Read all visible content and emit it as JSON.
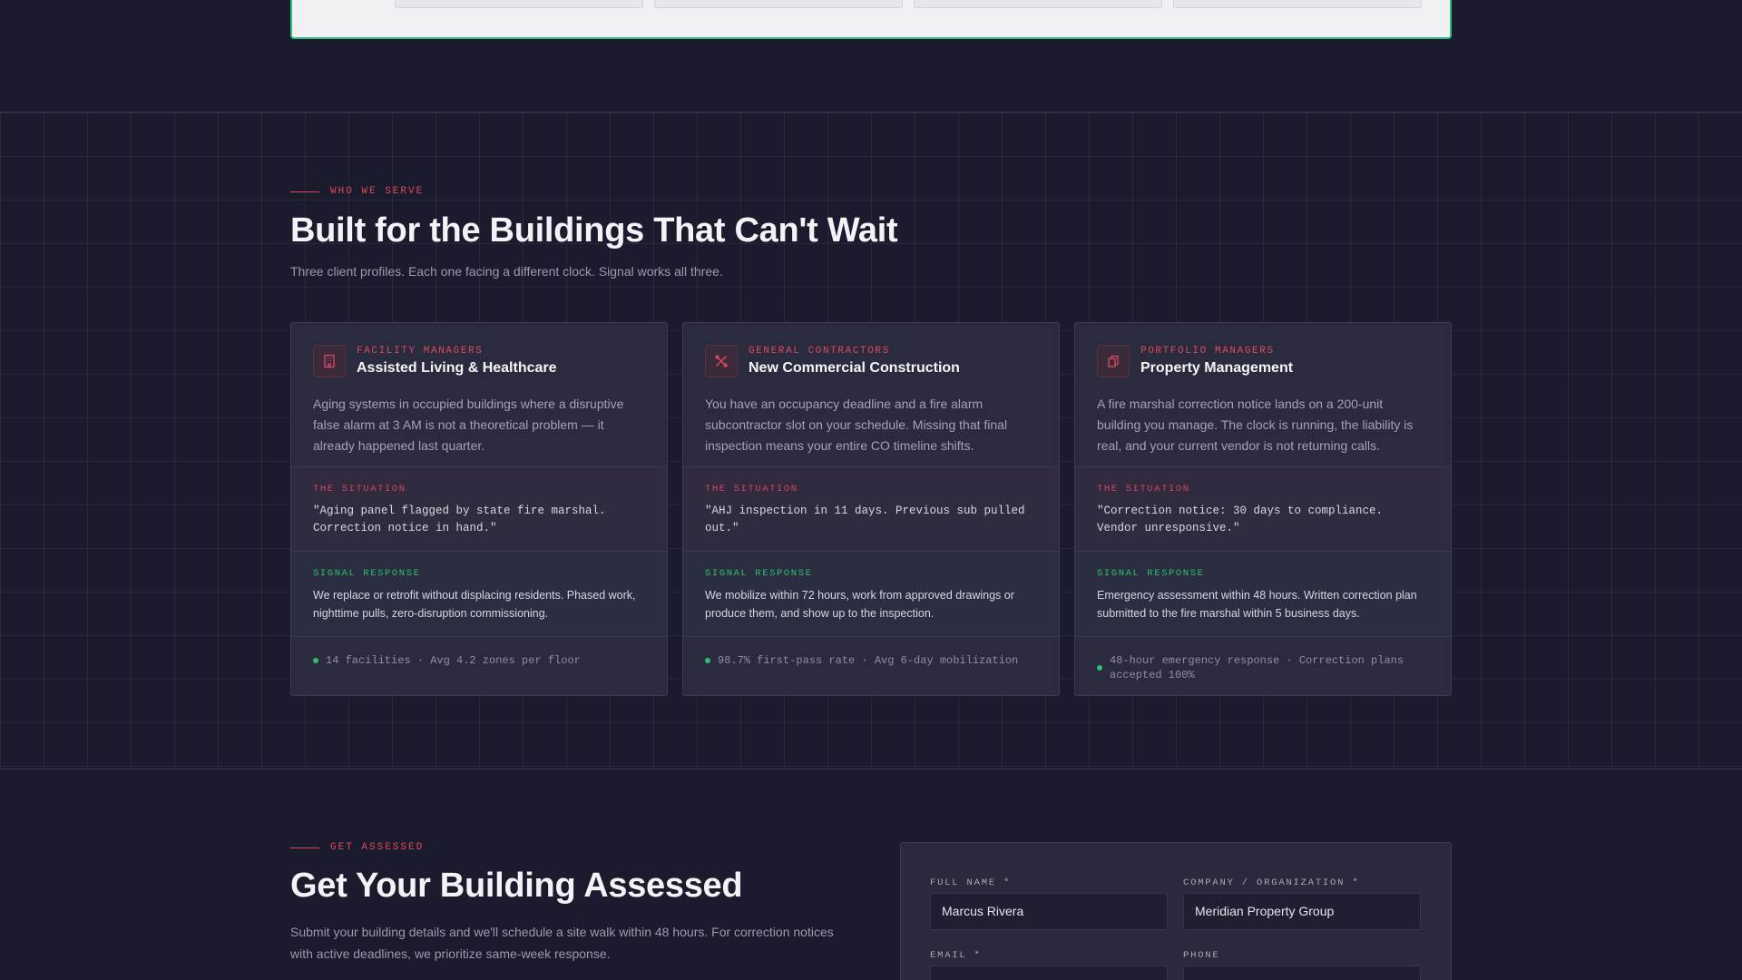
{
  "colors": {
    "background": "#1b1b2e",
    "accent": "#e0485c",
    "success": "#2fbf6e",
    "card": "#2a2b3e"
  },
  "who_we_serve": {
    "eyebrow": "WHO WE SERVE",
    "heading": "Built for the Buildings That Can't Wait",
    "subheading": "Three client profiles. Each one facing a different clock. Signal works all three.",
    "situation_label": "THE SITUATION",
    "response_label": "SIGNAL RESPONSE",
    "cards": [
      {
        "icon": "building-icon",
        "category": "FACILITY MANAGERS",
        "title": "Assisted Living & Healthcare",
        "description": "Aging systems in occupied buildings where a disruptive false alarm at 3 AM is not a theoretical problem — it already happened last quarter.",
        "situation": "\"Aging panel flagged by state fire marshal. Correction notice in hand.\"",
        "response": "We replace or retrofit without displacing residents. Phased work, nighttime pulls, zero-disruption commissioning.",
        "stat": "14 facilities · Avg 4.2 zones per floor"
      },
      {
        "icon": "tools-icon",
        "category": "GENERAL CONTRACTORS",
        "title": "New Commercial Construction",
        "description": "You have an occupancy deadline and a fire alarm subcontractor slot on your schedule. Missing that final inspection means your entire CO timeline shifts.",
        "situation": "\"AHJ inspection in 11 days. Previous sub pulled out.\"",
        "response": "We mobilize within 72 hours, work from approved drawings or produce them, and show up to the inspection.",
        "stat": "98.7% first-pass rate · Avg 6-day mobilization"
      },
      {
        "icon": "documents-icon",
        "category": "PORTFOLIO MANAGERS",
        "title": "Property Management",
        "description": "A fire marshal correction notice lands on a 200-unit building you manage. The clock is running, the liability is real, and your current vendor is not returning calls.",
        "situation": "\"Correction notice: 30 days to compliance. Vendor unresponsive.\"",
        "response": "Emergency assessment within 48 hours. Written correction plan submitted to the fire marshal within 5 business days.",
        "stat": "48-hour emergency response · Correction plans accepted 100%"
      }
    ]
  },
  "get_assessed": {
    "eyebrow": "GET ASSESSED",
    "heading": "Get Your Building Assessed",
    "subheading": "Submit your building details and we'll schedule a site walk within 48 hours. For correction notices with active deadlines, we prioritize same-week response.",
    "form": {
      "full_name_label": "FULL NAME *",
      "full_name_value": "Marcus Rivera",
      "company_label": "COMPANY / ORGANIZATION *",
      "company_value": "Meridian Property Group",
      "email_label": "EMAIL *",
      "phone_label": "PHONE"
    }
  }
}
